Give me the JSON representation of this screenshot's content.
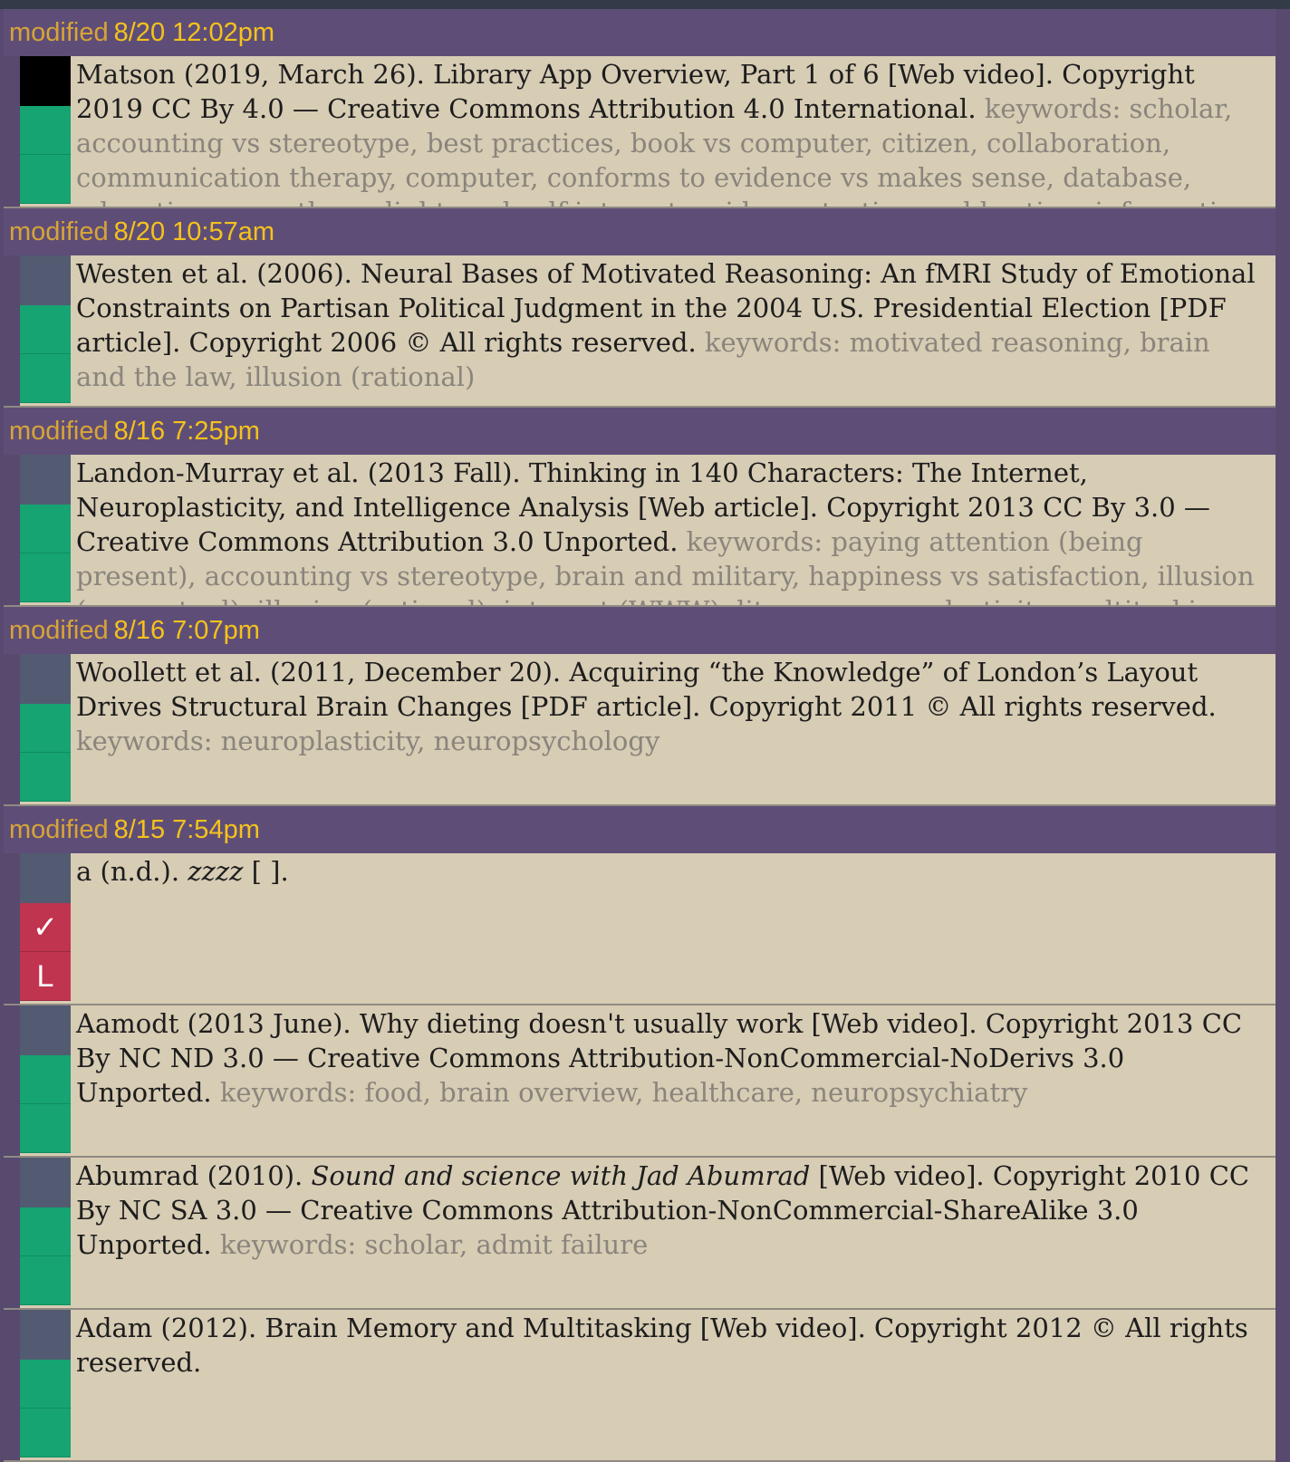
{
  "groups": [
    {
      "label": "modified",
      "when": "8/20 12:02pm",
      "records": [
        {
          "citation": "Matson (2019, March 26). Library App Overview, Part 1 of 6 [Web video]. Copyright 2019 CC By 4.0 — Creative Commons Attribution 4.0 International.",
          "keywords": "keywords: scholar, accounting vs stereotype, best practices, book vs computer, citizen, collaboration, communication therapy, computer, conforms to evidence vs makes sense, database, education, empathy, enlightened self-interest, evidence testing, gold-rating, information overload, lifelong learning, internet"
        }
      ]
    },
    {
      "label": "modified",
      "when": "8/20 10:57am",
      "records": [
        {
          "citation": "Westen et al. (2006). Neural Bases of Motivated Reasoning: An fMRI Study of Emotional Constraints on Partisan Political Judgment in the 2004 U.S. Presidential Election [PDF article]. Copyright 2006 © All rights reserved.",
          "keywords": "keywords: motivated reasoning, brain and the law, illusion (rational)"
        }
      ]
    },
    {
      "label": "modified",
      "when": "8/16 7:25pm",
      "records": [
        {
          "citation": "Landon-Murray et al. (2013 Fall). Thinking in 140 Characters: The Internet, Neuroplasticity, and Intelligence Analysis [Web article]. Copyright 2013 CC By 3.0 — Creative Commons Attribution 3.0 Unported.",
          "keywords": "keywords: paying attention (being present), accounting vs stereotype, brain and military, happiness vs satisfaction, illusion (perceptual), illusion (rational), internet (WWW), literacy, neuroplasticity, multitasking, analyst, cognition"
        }
      ]
    },
    {
      "label": "modified",
      "when": "8/16 7:07pm",
      "records": [
        {
          "citation": "Woollett et al. (2011, December 20). Acquiring “the Knowledge” of London’s Layout Drives Structural Brain Changes [PDF article]. Copyright 2011 © All rights reserved.",
          "keywords": "keywords: neuroplasticity, neuropsychology"
        }
      ]
    },
    {
      "label": "modified",
      "when": "8/15 7:54pm",
      "records": [
        {
          "author": "a (n.d.).",
          "title": "zzzz",
          "medium": "[ ].",
          "badges": [
            "✓",
            "L"
          ]
        },
        {
          "citation": "Aamodt (2013 June). Why dieting doesn't usually work [Web video]. Copyright 2013 CC By NC ND 3.0 — Creative Commons Attribution-NonCommercial-NoDerivs 3.0 Unported.",
          "keywords": "keywords: food, brain overview, healthcare, neuropsychiatry"
        },
        {
          "author": "Abumrad (2010).",
          "title": "Sound and science with Jad Abumrad",
          "rest": "[Web video]. Copyright 2010 CC By NC SA 3.0 — Creative Commons Attribution-NonCommercial-ShareAlike 3.0 Unported.",
          "keywords": "keywords: scholar, admit failure"
        },
        {
          "citation": "Adam (2012). Brain Memory and Multitasking [Web video]. Copyright 2012 © All rights reserved."
        }
      ]
    }
  ],
  "colors": {
    "header_bg": "#5e4e77",
    "header_label": "#d8a437",
    "header_time": "#f5c21c",
    "row_bg": "#d7ccb4",
    "tile_green": "#16a473",
    "tile_slate": "#525b71",
    "tile_red": "#c0344f",
    "keyword_text": "#8a857c"
  }
}
